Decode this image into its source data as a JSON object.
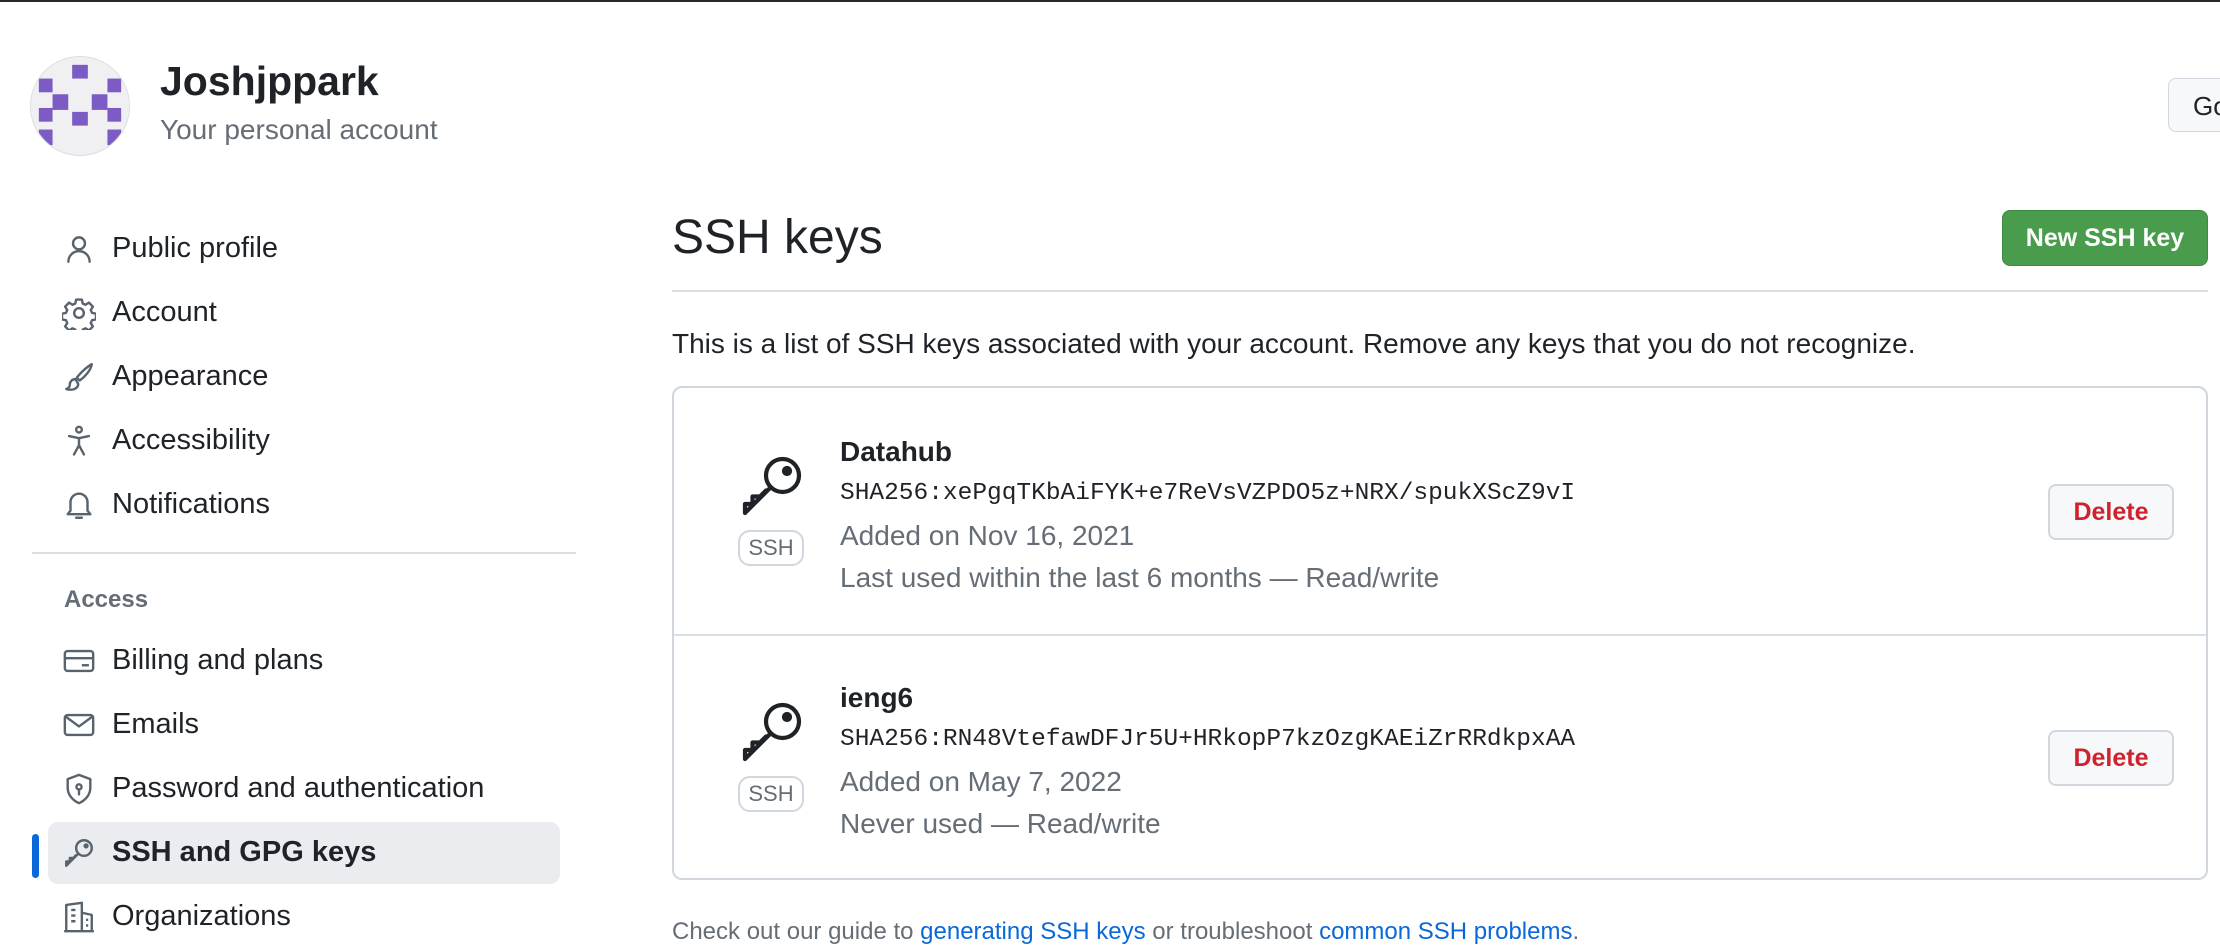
{
  "profile": {
    "username": "Joshjppark",
    "subtitle": "Your personal account",
    "goto_button_label": "Go"
  },
  "sidebar": {
    "items": [
      {
        "label": "Public profile",
        "icon": "person-icon"
      },
      {
        "label": "Account",
        "icon": "gear-icon"
      },
      {
        "label": "Appearance",
        "icon": "paintbrush-icon"
      },
      {
        "label": "Accessibility",
        "icon": "accessibility-icon"
      },
      {
        "label": "Notifications",
        "icon": "bell-icon"
      }
    ],
    "access_heading": "Access",
    "access_items": [
      {
        "label": "Billing and plans",
        "icon": "credit-card-icon"
      },
      {
        "label": "Emails",
        "icon": "mail-icon"
      },
      {
        "label": "Password and authentication",
        "icon": "shield-lock-icon"
      },
      {
        "label": "SSH and GPG keys",
        "icon": "key-icon",
        "selected": true
      },
      {
        "label": "Organizations",
        "icon": "organization-icon"
      }
    ]
  },
  "main": {
    "title": "SSH keys",
    "new_key_button": "New SSH key",
    "description": "This is a list of SSH keys associated with your account. Remove any keys that you do not recognize.",
    "keys": [
      {
        "name": "Datahub",
        "fingerprint": "SHA256:xePgqTKbAiFYK+e7ReVsVZPDO5z+NRX/spukXScZ9vI",
        "added": "Added on Nov 16, 2021",
        "last_used": "Last used within the last 6 months — Read/write",
        "badge": "SSH",
        "delete_label": "Delete"
      },
      {
        "name": "ieng6",
        "fingerprint": "SHA256:RN48VtefawDFJr5U+HRkopP7kzOzgKAEiZrRRdkpxAA",
        "added": "Added on May 7, 2022",
        "last_used": "Never used — Read/write",
        "badge": "SSH",
        "delete_label": "Delete"
      }
    ],
    "footer": {
      "prefix": "Check out our guide to ",
      "link1": "generating SSH keys",
      "middle": " or troubleshoot ",
      "link2": "common SSH problems",
      "suffix": "."
    }
  },
  "colors": {
    "accent": "#0969da",
    "primary_button": "#4a9c4d",
    "danger": "#cf222e",
    "avatar_identicon": "#7c5cc4"
  }
}
